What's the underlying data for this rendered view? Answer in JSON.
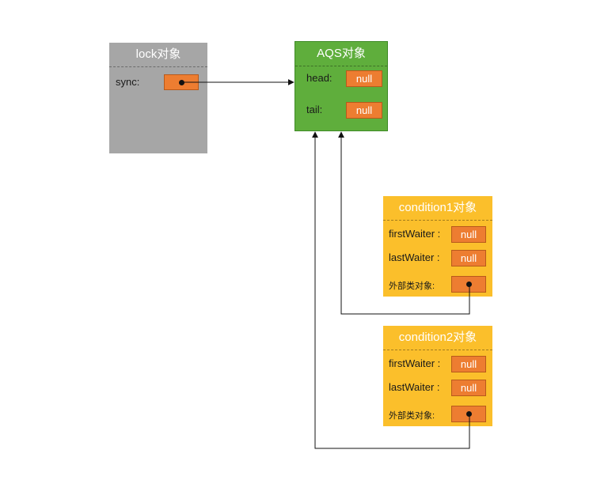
{
  "lock": {
    "title": "lock对象",
    "sync_label": "sync:"
  },
  "aqs": {
    "title": "AQS对象",
    "head_label": "head:",
    "head_value": "null",
    "tail_label": "tail:",
    "tail_value": "null"
  },
  "condition1": {
    "title": "condition1对象",
    "first_label": "firstWaiter :",
    "first_value": "null",
    "last_label": "lastWaiter :",
    "last_value": "null",
    "outer_label": "外部类对象:"
  },
  "condition2": {
    "title": "condition2对象",
    "first_label": "firstWaiter :",
    "first_value": "null",
    "last_label": "lastWaiter :",
    "last_value": "null",
    "outer_label": "外部类对象:"
  },
  "colors": {
    "lock_box": "#a6a6a6",
    "aqs_box": "#5fae3c",
    "condition_box": "#fbbf2b",
    "slot": "#ed7d31"
  }
}
